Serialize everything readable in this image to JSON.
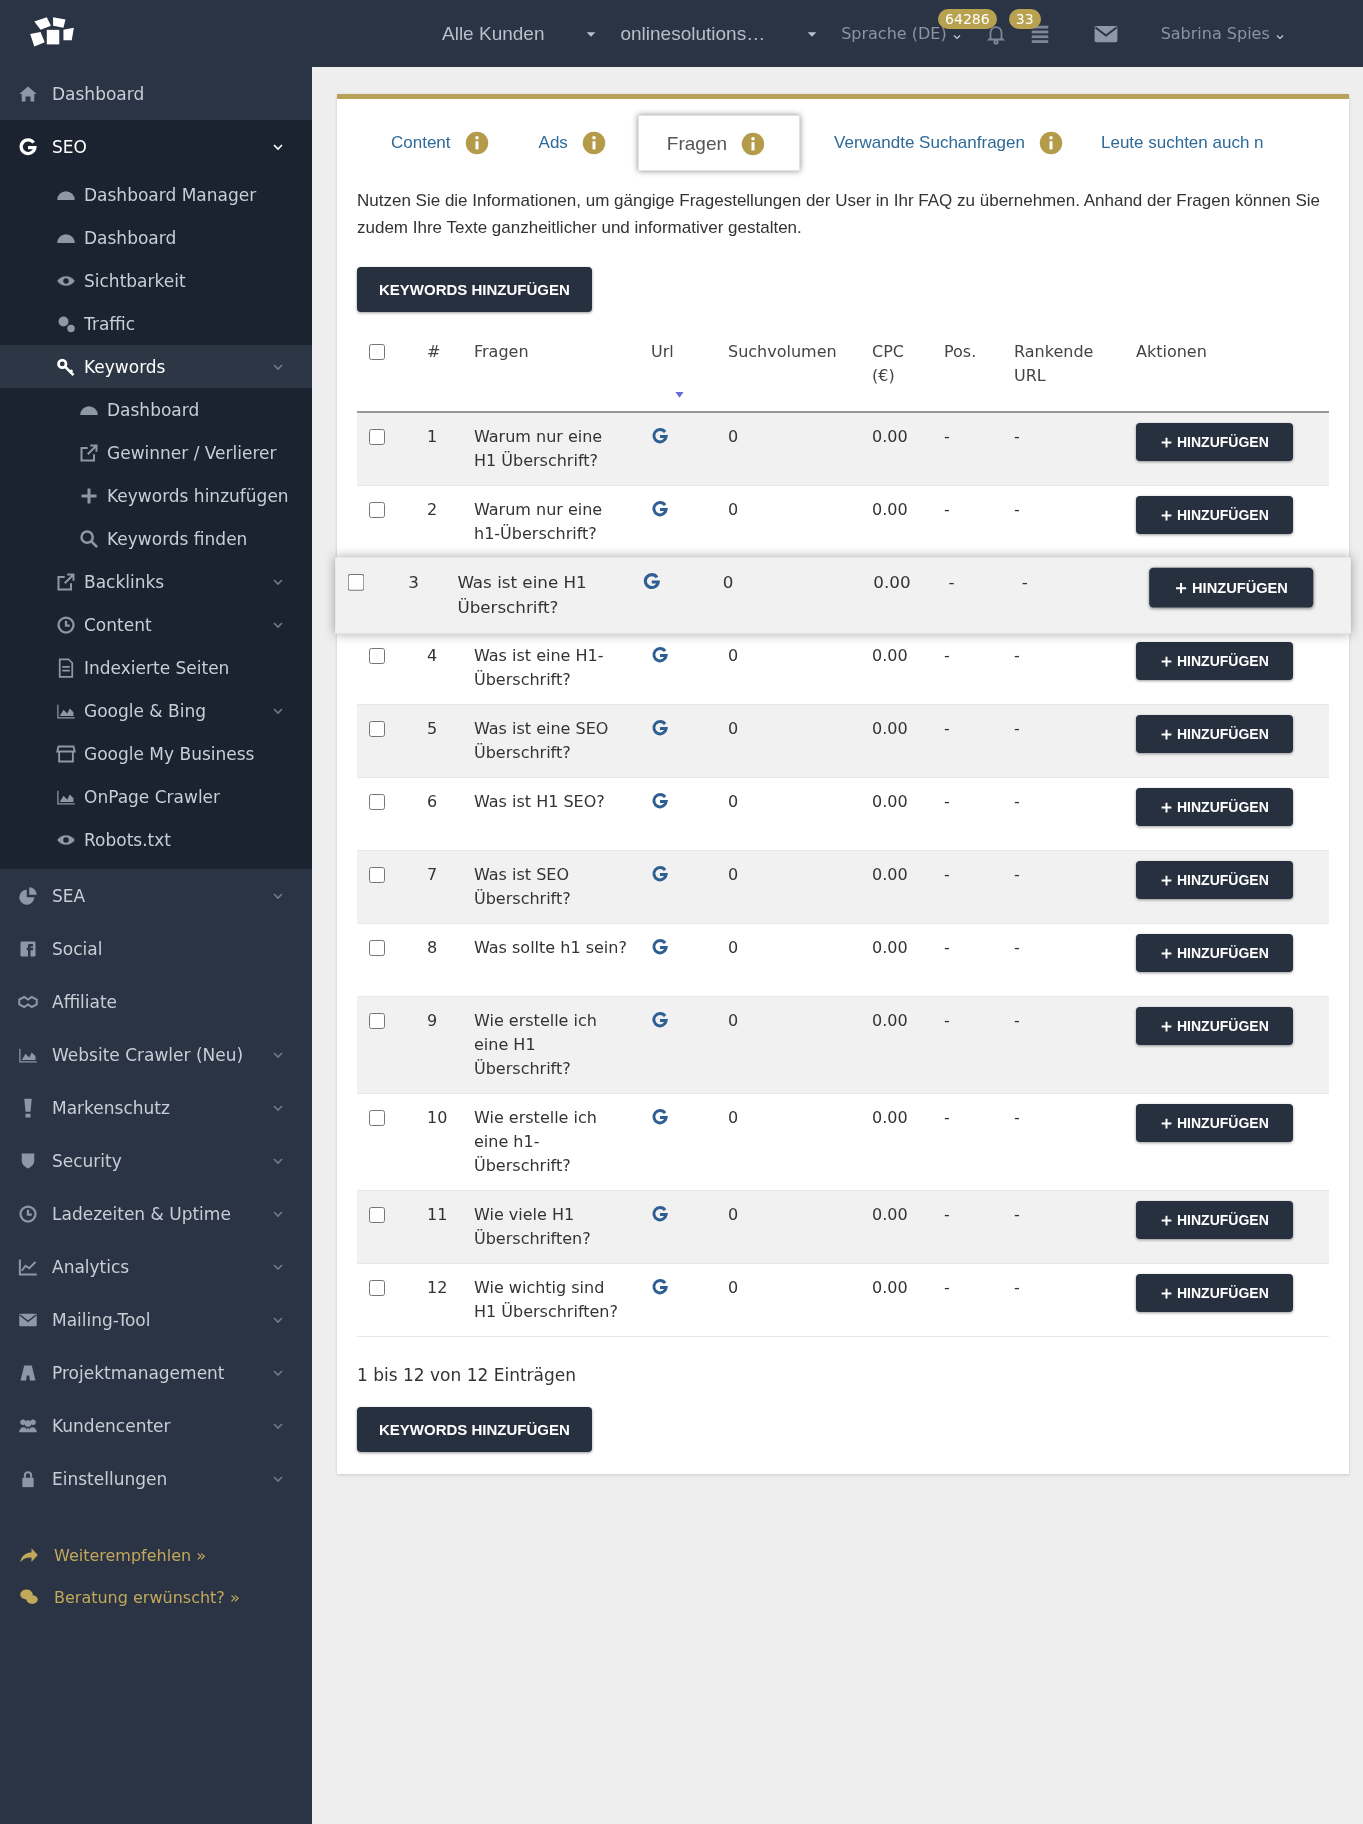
{
  "topbar": {
    "customer_select": "Alle Kunden",
    "project_select": "onlinesolutions…",
    "language": "Sprache (DE)",
    "notifications_badge": "64286",
    "tasks_badge": "33",
    "user": "Sabrina Spies"
  },
  "sidebar": {
    "items": [
      {
        "label": "Dashboard"
      },
      {
        "label": "SEO",
        "expanded": true,
        "children": [
          {
            "label": "Dashboard Manager",
            "selected": false
          },
          {
            "label": "Dashboard",
            "selected": false
          },
          {
            "label": "Sichtbarkeit",
            "selected": false
          },
          {
            "label": "Traffic",
            "selected": false
          },
          {
            "label": "Keywords",
            "expanded": true,
            "selected": true,
            "children": [
              {
                "label": "Dashboard",
                "selected": false
              },
              {
                "label": "Gewinner / Verlierer",
                "selected": false
              },
              {
                "label": "Keywords hinzufügen",
                "selected": false
              },
              {
                "label": "Keywords finden",
                "selected": false
              }
            ]
          },
          {
            "label": "Backlinks",
            "expanded": false,
            "selected": false
          },
          {
            "label": "Content",
            "expanded": false,
            "selected": false
          },
          {
            "label": "Indexierte Seiten",
            "selected": false
          },
          {
            "label": "Google & Bing",
            "expanded": false,
            "selected": false
          },
          {
            "label": "Google My Business",
            "selected": false
          },
          {
            "label": "OnPage Crawler",
            "selected": false
          },
          {
            "label": "Robots.txt",
            "selected": false
          }
        ]
      },
      {
        "label": "SEA",
        "expanded": false
      },
      {
        "label": "Social"
      },
      {
        "label": "Affiliate"
      },
      {
        "label": "Website Crawler (Neu)",
        "expanded": false
      },
      {
        "label": "Markenschutz",
        "expanded": false
      },
      {
        "label": "Security",
        "expanded": false
      },
      {
        "label": "Ladezeiten & Uptime",
        "expanded": false
      },
      {
        "label": "Analytics",
        "expanded": false
      },
      {
        "label": "Mailing-Tool",
        "expanded": false
      },
      {
        "label": "Projektmanagement",
        "expanded": false
      },
      {
        "label": "Kundencenter",
        "expanded": false
      },
      {
        "label": "Einstellungen",
        "expanded": false
      }
    ],
    "footer_links": [
      "Weiterempfehlen »",
      "Beratung erwünscht? »"
    ]
  },
  "tabs": [
    {
      "label": "Content",
      "info_icon": true,
      "selected": false
    },
    {
      "label": "Ads",
      "info_icon": true,
      "selected": false
    },
    {
      "label": "Fragen",
      "info_icon": true,
      "selected": true
    },
    {
      "label": "Verwandte Suchanfragen",
      "info_icon": true,
      "selected": false
    },
    {
      "label": "Leute suchten auch n",
      "info_icon": false,
      "selected": false
    }
  ],
  "description": "Nutzen Sie die Informationen, um gängige Fragestellungen der User in Ihr FAQ zu übernehmen. Anhand der Fragen können Sie zudem Ihre Texte ganzheitlicher und informativer gestalten.",
  "add_button": "KEYWORDS HINZUFÜGEN",
  "table": {
    "select_all_checked": false,
    "columns": [
      {
        "label": "#",
        "sorted": false
      },
      {
        "label": "Fragen",
        "sorted": false
      },
      {
        "label": "Url",
        "sorted": true
      },
      {
        "label": "Suchvolumen",
        "sorted": false
      },
      {
        "label": "CPC (€)",
        "sorted": false
      },
      {
        "label": "Pos.",
        "sorted": false
      },
      {
        "label": "Rankende URL",
        "sorted": false
      },
      {
        "label": "Aktionen",
        "sorted": false
      }
    ],
    "rows": [
      {
        "number": "1",
        "question": "Warum nur eine H1 Überschrift?",
        "volume": "0",
        "cpc": "0.00",
        "pos": "-",
        "ranking_url": "-",
        "action": "HINZUFÜGEN",
        "checked": false,
        "highlighted": false
      },
      {
        "number": "2",
        "question": "Warum nur eine h1-Überschrift?",
        "volume": "0",
        "cpc": "0.00",
        "pos": "-",
        "ranking_url": "-",
        "action": "HINZUFÜGEN",
        "checked": false,
        "highlighted": false
      },
      {
        "number": "3",
        "question": "Was ist eine H1 Überschrift?",
        "volume": "0",
        "cpc": "0.00",
        "pos": "-",
        "ranking_url": "-",
        "action": "HINZUFÜGEN",
        "checked": false,
        "highlighted": true
      },
      {
        "number": "4",
        "question": "Was ist eine H1-Überschrift?",
        "volume": "0",
        "cpc": "0.00",
        "pos": "-",
        "ranking_url": "-",
        "action": "HINZUFÜGEN",
        "checked": false,
        "highlighted": false
      },
      {
        "number": "5",
        "question": "Was ist eine SEO Überschrift?",
        "volume": "0",
        "cpc": "0.00",
        "pos": "-",
        "ranking_url": "-",
        "action": "HINZUFÜGEN",
        "checked": false,
        "highlighted": false
      },
      {
        "number": "6",
        "question": "Was ist H1 SEO?",
        "volume": "0",
        "cpc": "0.00",
        "pos": "-",
        "ranking_url": "-",
        "action": "HINZUFÜGEN",
        "checked": false,
        "highlighted": false
      },
      {
        "number": "7",
        "question": "Was ist SEO Überschrift?",
        "volume": "0",
        "cpc": "0.00",
        "pos": "-",
        "ranking_url": "-",
        "action": "HINZUFÜGEN",
        "checked": false,
        "highlighted": false
      },
      {
        "number": "8",
        "question": "Was sollte h1 sein?",
        "volume": "0",
        "cpc": "0.00",
        "pos": "-",
        "ranking_url": "-",
        "action": "HINZUFÜGEN",
        "checked": false,
        "highlighted": false
      },
      {
        "number": "9",
        "question": "Wie erstelle ich eine H1 Überschrift?",
        "volume": "0",
        "cpc": "0.00",
        "pos": "-",
        "ranking_url": "-",
        "action": "HINZUFÜGEN",
        "checked": false,
        "highlighted": false
      },
      {
        "number": "10",
        "question": "Wie erstelle ich eine h1-Überschrift?",
        "volume": "0",
        "cpc": "0.00",
        "pos": "-",
        "ranking_url": "-",
        "action": "HINZUFÜGEN",
        "checked": false,
        "highlighted": false
      },
      {
        "number": "11",
        "question": "Wie viele H1 Überschriften?",
        "volume": "0",
        "cpc": "0.00",
        "pos": "-",
        "ranking_url": "-",
        "action": "HINZUFÜGEN",
        "checked": false,
        "highlighted": false
      },
      {
        "number": "12",
        "question": "Wie wichtig sind H1 Überschriften?",
        "volume": "0",
        "cpc": "0.00",
        "pos": "-",
        "ranking_url": "-",
        "action": "HINZUFÜGEN",
        "checked": false,
        "highlighted": false
      }
    ]
  },
  "entries_info": "1 bis 12 von 12 Einträgen",
  "bottom_button": "KEYWORDS HINZUFÜGEN"
}
